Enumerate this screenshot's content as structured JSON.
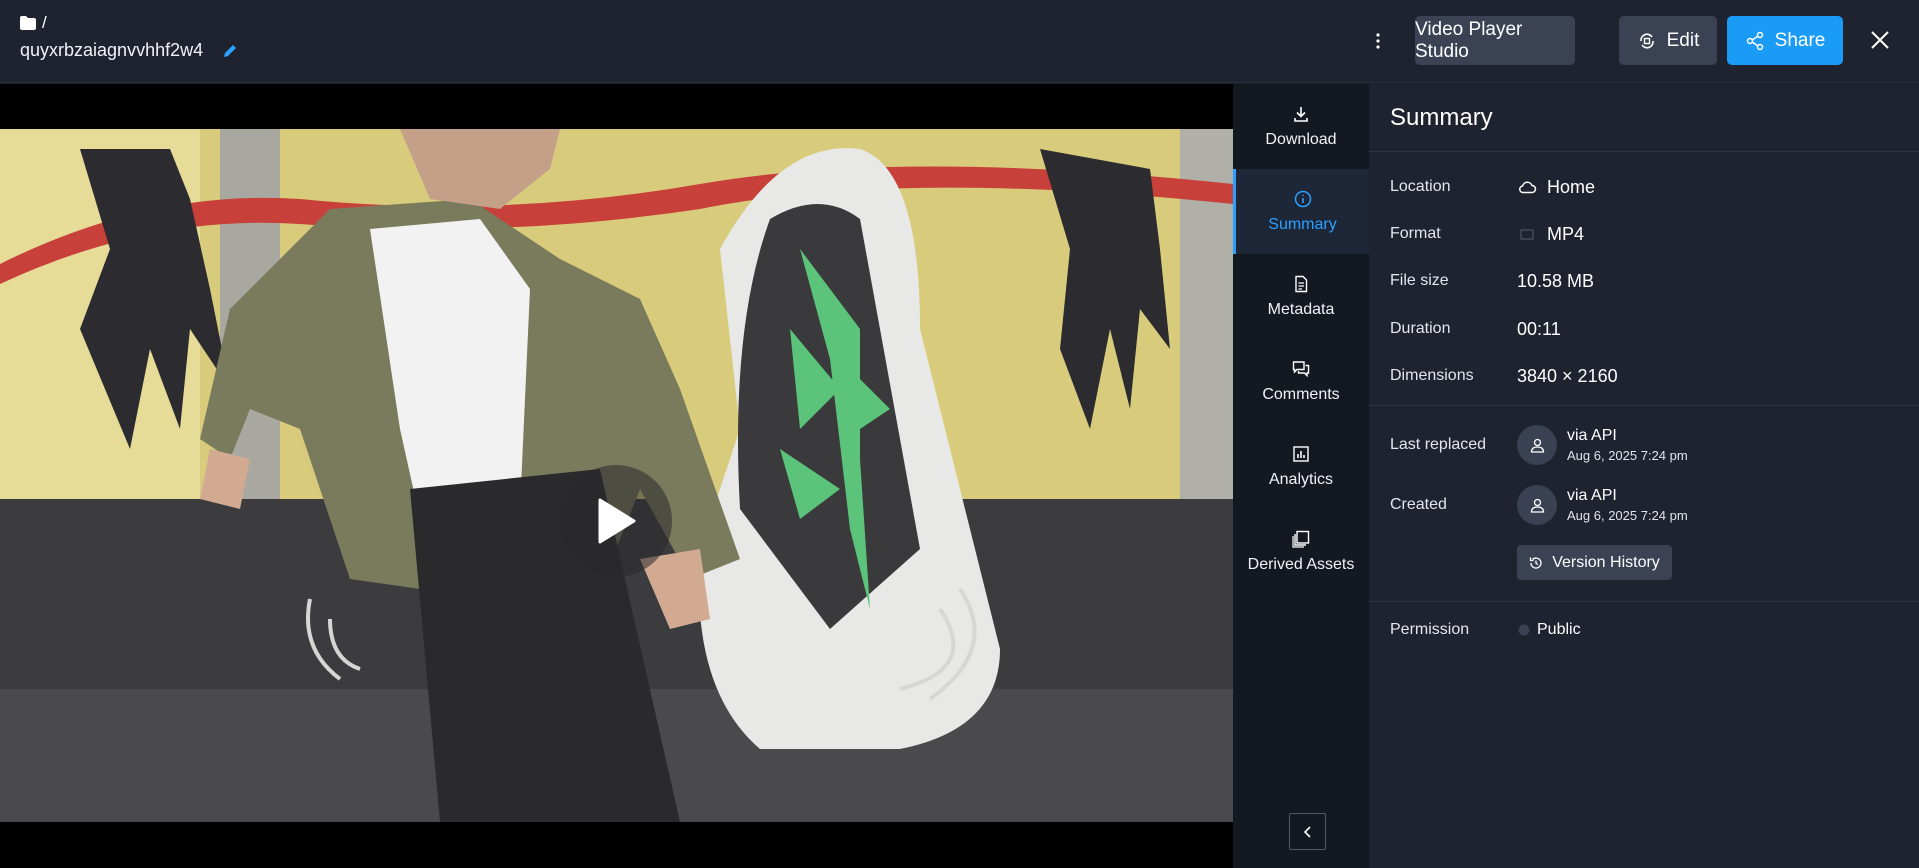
{
  "header": {
    "breadcrumb_sep": "/",
    "asset_name": "quyxrbzaiagnvvhhf2w4",
    "buttons": {
      "video_player_studio": "Video Player Studio",
      "edit": "Edit",
      "share": "Share"
    }
  },
  "tabs": [
    {
      "label": "Download",
      "icon": "download-icon"
    },
    {
      "label": "Summary",
      "icon": "info-icon",
      "active": true
    },
    {
      "label": "Metadata",
      "icon": "document-icon"
    },
    {
      "label": "Comments",
      "icon": "comments-icon"
    },
    {
      "label": "Analytics",
      "icon": "chart-icon"
    },
    {
      "label": "Derived Assets",
      "icon": "layers-icon"
    }
  ],
  "summary": {
    "title": "Summary",
    "location": {
      "label": "Location",
      "value": "Home"
    },
    "format": {
      "label": "Format",
      "value": "MP4"
    },
    "file_size": {
      "label": "File size",
      "value": "10.58 MB"
    },
    "duration": {
      "label": "Duration",
      "value": "00:11"
    },
    "dimensions": {
      "label": "Dimensions",
      "value": "3840 × 2160"
    },
    "last_replaced": {
      "label": "Last replaced",
      "who": "via API",
      "when": "Aug 6, 2025 7:24 pm"
    },
    "created": {
      "label": "Created",
      "who": "via API",
      "when": "Aug 6, 2025 7:24 pm"
    },
    "version_history": "Version History",
    "permission": {
      "label": "Permission",
      "value": "Public"
    }
  },
  "colors": {
    "accent": "#1a9bf6",
    "active_tab": "#2ba1ff",
    "panel_bg": "#1f2330",
    "button_bg": "#3b4254"
  }
}
